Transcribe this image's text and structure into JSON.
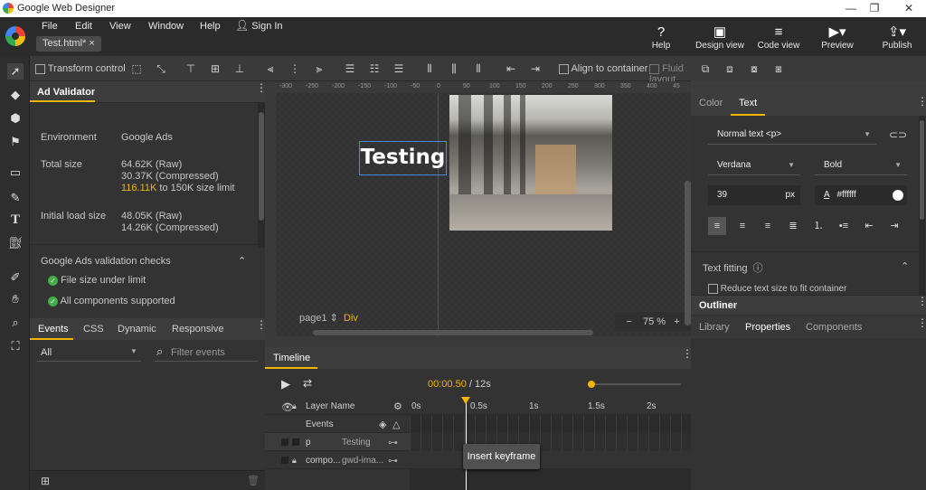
{
  "window": {
    "title": "Google Web Designer",
    "min": "—",
    "max": "❐",
    "close": "✕"
  },
  "menu": {
    "items": [
      "File",
      "Edit",
      "View",
      "Window",
      "Help"
    ],
    "sign_in": "Sign In"
  },
  "file_tab": {
    "label": "Test.html*",
    "close": "×"
  },
  "top_buttons": [
    {
      "label": "Help",
      "icon": "?"
    },
    {
      "label": "Design view",
      "icon": "▣"
    },
    {
      "label": "Code view",
      "icon": "≡"
    },
    {
      "label": "Preview",
      "icon": "▶▾"
    },
    {
      "label": "Publish",
      "icon": "⇪▾"
    }
  ],
  "toolbar": {
    "transform_control": "Transform control",
    "align_to_container": "Align to container",
    "fluid_layout": "Fluid layout"
  },
  "ad_validator": {
    "title": "Ad Validator",
    "environment_label": "Environment",
    "environment_value": "Google Ads",
    "total_size_label": "Total size",
    "total_raw": "64.62K (Raw)",
    "total_compressed": "30.37K (Compressed)",
    "limit_value": "116.11K",
    "limit_text": "to 150K size limit",
    "initial_label": "Initial load size",
    "initial_raw": "48.05K (Raw)",
    "initial_compressed": "14.26K (Compressed)",
    "checks_title": "Google Ads validation checks",
    "check1": "File size under limit",
    "check2": "All components supported"
  },
  "events_panel": {
    "tabs": [
      "Events",
      "CSS",
      "Dynamic",
      "Responsive"
    ],
    "filter_value": "All",
    "search_placeholder": "Filter events"
  },
  "canvas": {
    "ruler_labels": [
      "-300",
      "-250",
      "-200",
      "-150",
      "-100",
      "-50",
      "0",
      "50",
      "100",
      "150",
      "200",
      "250",
      "300",
      "350",
      "400",
      "45"
    ],
    "text_element": "Testing",
    "page": "page1 ⇕",
    "element_type": "Div",
    "zoom_minus": "−",
    "zoom_value": "75",
    "zoom_unit": "%",
    "zoom_plus": "+"
  },
  "right_panel": {
    "tabs": [
      "Color",
      "Text"
    ],
    "text_style": "Normal text <p>",
    "font": "Verdana",
    "weight": "Bold",
    "size": "39",
    "size_unit": "px",
    "color_letter": "A",
    "color_value": "#ffffff",
    "text_fitting": "Text fitting",
    "reduce_text": "Reduce text size to fit container",
    "outliner": "Outliner",
    "lower_tabs": [
      "Library",
      "Properties",
      "Components"
    ]
  },
  "timeline": {
    "title": "Timeline",
    "time_current": "00:00.50",
    "time_total": "/ 12s",
    "marks": [
      "0s",
      "0.5s",
      "1s",
      "1.5s",
      "2s"
    ],
    "layer_header": "Layer Name",
    "events_row": "Events",
    "layers": [
      {
        "name": "p",
        "value": "Testing"
      },
      {
        "name": "compo...",
        "value": "gwd-ima..."
      }
    ],
    "tooltip": "Insert keyframe"
  },
  "colors": {
    "accent": "#f4b400",
    "check": "#3fae49"
  }
}
